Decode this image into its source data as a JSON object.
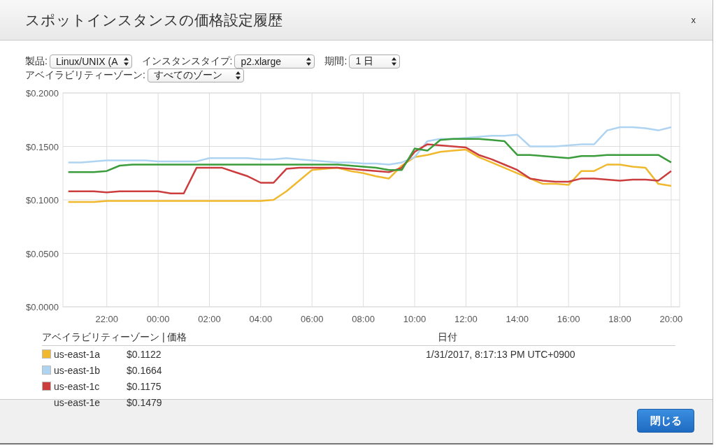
{
  "dialog": {
    "title": "スポットインスタンスの価格設定履歴",
    "close": "x"
  },
  "filter_rows": [
    [
      {
        "label": "製品:",
        "value": "Linux/UNIX (A"
      },
      {
        "label": "インスタンスタイプ:",
        "value": "p2.xlarge"
      },
      {
        "label": "期間:",
        "value": "1 日"
      }
    ],
    [
      {
        "label": "アベイラビリティーゾーン:",
        "value": "すべてのゾーン"
      }
    ]
  ],
  "chart": {
    "chart_data": {
      "type": "line",
      "categories": [
        null,
        null,
        null,
        "22:00",
        null,
        null,
        null,
        "00:00",
        null,
        null,
        null,
        "02:00",
        null,
        null,
        null,
        "04:00",
        null,
        null,
        null,
        "06:00",
        null,
        null,
        null,
        "08:00",
        null,
        null,
        null,
        "10:00",
        null,
        null,
        null,
        "12:00",
        null,
        null,
        null,
        "14:00",
        null,
        null,
        null,
        "16:00",
        null,
        null,
        null,
        "18:00",
        null,
        null,
        null,
        "20:00"
      ],
      "series": [
        {
          "name": "us-east-1a",
          "color": "#f0b92d",
          "values": [
            0.098,
            0.098,
            0.098,
            0.099,
            0.099,
            0.099,
            0.099,
            0.099,
            0.099,
            0.099,
            0.099,
            0.099,
            0.099,
            0.099,
            0.099,
            0.099,
            0.1,
            0.108,
            0.118,
            0.128,
            0.129,
            0.13,
            0.127,
            0.125,
            0.122,
            0.12,
            0.132,
            0.14,
            0.142,
            0.145,
            0.146,
            0.147,
            0.14,
            0.135,
            0.13,
            0.125,
            0.12,
            0.115,
            0.115,
            0.114,
            0.127,
            0.127,
            0.133,
            0.133,
            0.131,
            0.13,
            0.115,
            0.113
          ]
        },
        {
          "name": "us-east-1b",
          "color": "#aed4f2",
          "values": [
            0.135,
            0.135,
            0.136,
            0.137,
            0.137,
            0.137,
            0.137,
            0.136,
            0.136,
            0.136,
            0.136,
            0.139,
            0.139,
            0.139,
            0.139,
            0.138,
            0.138,
            0.139,
            0.138,
            0.137,
            0.136,
            0.135,
            0.135,
            0.134,
            0.134,
            0.133,
            0.135,
            0.14,
            0.155,
            0.157,
            0.157,
            0.158,
            0.159,
            0.16,
            0.16,
            0.161,
            0.15,
            0.15,
            0.15,
            0.151,
            0.152,
            0.152,
            0.165,
            0.168,
            0.168,
            0.167,
            0.165,
            0.168
          ]
        },
        {
          "name": "us-east-1c",
          "color": "#cc3d3d",
          "values": [
            0.108,
            0.108,
            0.108,
            0.107,
            0.108,
            0.108,
            0.108,
            0.108,
            0.106,
            0.106,
            0.13,
            0.13,
            0.13,
            0.126,
            0.122,
            0.116,
            0.116,
            0.129,
            0.13,
            0.13,
            0.13,
            0.13,
            0.129,
            0.128,
            0.127,
            0.126,
            0.13,
            0.145,
            0.152,
            0.151,
            0.15,
            0.149,
            0.142,
            0.138,
            0.133,
            0.128,
            0.12,
            0.118,
            0.117,
            0.117,
            0.12,
            0.12,
            0.119,
            0.118,
            0.119,
            0.119,
            0.118,
            0.127
          ]
        },
        {
          "name": "us-east-1e",
          "color": "#3a9c3a",
          "values": [
            0.126,
            0.126,
            0.126,
            0.127,
            0.132,
            0.133,
            0.133,
            0.133,
            0.133,
            0.133,
            0.133,
            0.133,
            0.133,
            0.133,
            0.133,
            0.133,
            0.133,
            0.133,
            0.133,
            0.133,
            0.133,
            0.133,
            0.132,
            0.131,
            0.13,
            0.128,
            0.128,
            0.148,
            0.146,
            0.156,
            0.157,
            0.157,
            0.157,
            0.156,
            0.155,
            0.142,
            0.142,
            0.141,
            0.14,
            0.139,
            0.141,
            0.141,
            0.142,
            0.142,
            0.142,
            0.142,
            0.142,
            0.135
          ]
        }
      ],
      "grid": true,
      "ylim": [
        0,
        0.2
      ],
      "yticks": [
        {
          "value": 0,
          "label": "$0.0000"
        },
        {
          "value": 0.05,
          "label": "$0.0500"
        },
        {
          "value": 0.1,
          "label": "$0.1000"
        },
        {
          "value": 0.15,
          "label": "$0.1500"
        },
        {
          "value": 0.2,
          "label": "$0.2000"
        }
      ]
    }
  },
  "legend": {
    "header": "アベイラビリティーゾーン | 価格",
    "date_header": "日付",
    "date": "1/31/2017, 8:17:13 PM UTC+0900",
    "rows": [
      {
        "price": "$0.1122",
        "color": "#f0b92d"
      },
      {
        "price": "$0.1664",
        "color": "#aed4f2"
      },
      {
        "price": "$0.1175",
        "color": "#cc3d3d"
      },
      {
        "price": "$0.1479"
      }
    ]
  },
  "footer": {
    "close_button": "閉じる"
  }
}
